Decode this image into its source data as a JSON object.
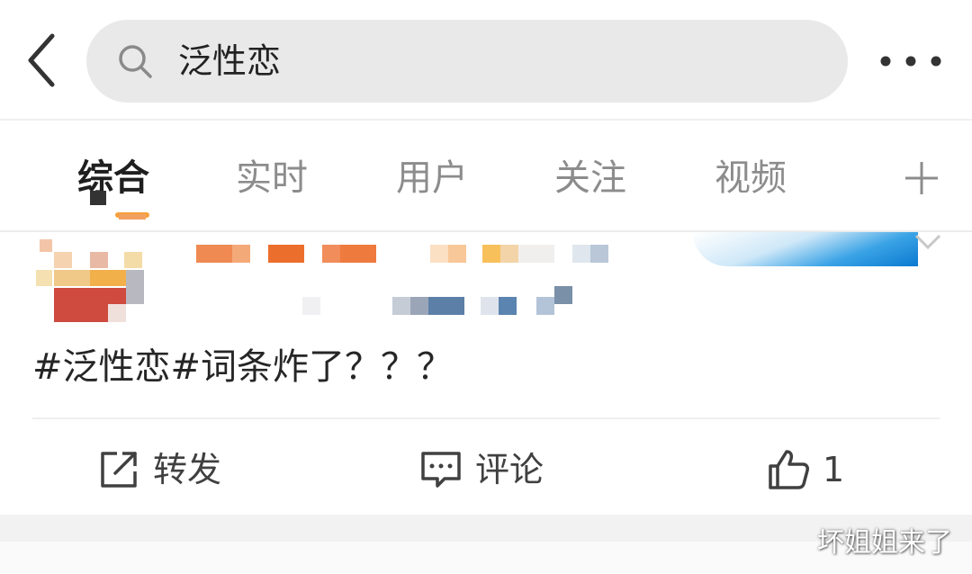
{
  "header": {
    "search_query": "泛性恋"
  },
  "tabs": [
    {
      "label": "综合",
      "active": true
    },
    {
      "label": "实时",
      "active": false
    },
    {
      "label": "用户",
      "active": false
    },
    {
      "label": "关注",
      "active": false
    },
    {
      "label": "视频",
      "active": false
    }
  ],
  "post": {
    "text": "#泛性恋#词条炸了？？？",
    "actions": {
      "repost_label": "转发",
      "comment_label": "评论",
      "like_count": "1"
    }
  },
  "watermark": "坏姐姐来了",
  "colors": {
    "search_bg": "#e9e9ea",
    "active_tab": "#1f1f1f",
    "inactive_tab": "#8c8c8c",
    "tab_indicator": "#f6a13a",
    "separator_band": "#f2f2f2"
  },
  "icons": {
    "back": "chevron-left-icon",
    "search": "magnifier-icon",
    "more": "three-dots-icon",
    "add_tab": "plus-icon",
    "repost": "share-square-arrow-icon",
    "comment": "speech-bubble-icon",
    "like": "thumbs-up-icon",
    "post_menu": "chevron-down-icon"
  }
}
